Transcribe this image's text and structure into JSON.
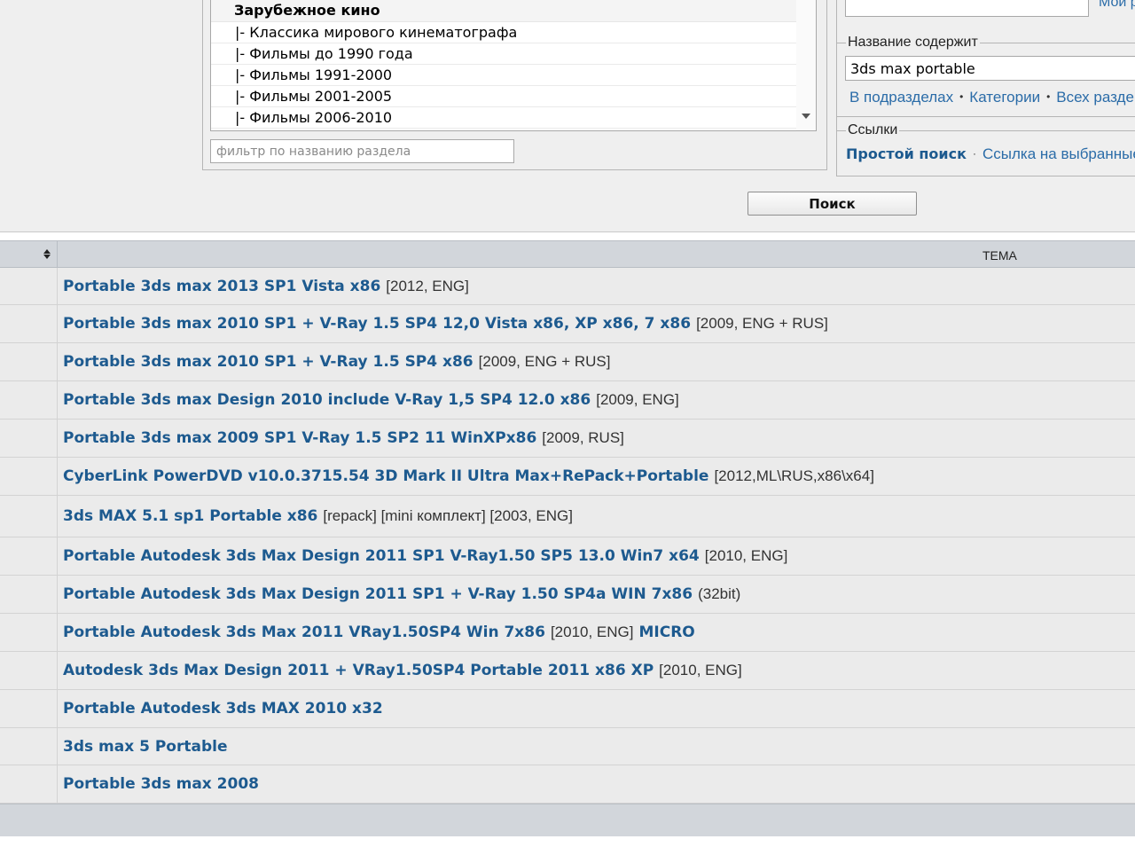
{
  "forum_list": {
    "category": "Зарубежное кино",
    "options": [
      "|- Классика мирового кинематографа",
      "|- Фильмы до 1990 года",
      "|- Фильмы 1991-2000",
      "|- Фильмы 2001-2005",
      "|- Фильмы 2006-2010"
    ],
    "filter_placeholder": "фильтр по названию раздела"
  },
  "right_panel": {
    "my_link": "Мои р",
    "title_contains": {
      "legend": "Название содержит",
      "value": "3ds max portable",
      "scope_links": [
        "В подразделах",
        "Категории",
        "Всех разде"
      ]
    },
    "links": {
      "legend": "Ссылки",
      "simple_search": "Простой поиск",
      "selected_link": "Ссылка на выбранные"
    }
  },
  "search_button": "Поиск",
  "results": {
    "column_header": "ТЕМА",
    "rows": [
      {
        "title": "Portable 3ds max 2013 SP1 Vista x86",
        "meta": "[2012, ENG]",
        "extra": ""
      },
      {
        "title": "Portable 3ds max 2010 SP1 + V-Ray 1.5 SP4 12,0 Vista x86, XP x86, 7 x86",
        "meta": "[2009, ENG + RUS]",
        "extra": ""
      },
      {
        "title": "Portable 3ds max 2010 SP1 + V-Ray 1.5 SP4 x86",
        "meta": "[2009, ENG + RUS]",
        "extra": ""
      },
      {
        "title": "Portable 3ds max Design 2010 include V-Ray 1,5 SP4 12.0 x86",
        "meta": "[2009, ENG]",
        "extra": ""
      },
      {
        "title": "Portable 3ds max 2009 SP1 V-Ray 1.5 SP2 11 WinXPx86",
        "meta": "[2009, RUS]",
        "extra": ""
      },
      {
        "title": "CyberLink PowerDVD v10.0.3715.54 3D Mark II Ultra Max+RePack+Portable",
        "meta": "[2012,ML\\RUS,x86\\x64]",
        "extra": ""
      },
      {
        "title": "3ds MAX 5.1 sp1 Portable x86",
        "meta": "[repack] [mini комплект] [2003, ENG]",
        "extra": ""
      },
      {
        "title": "Portable Autodesk 3ds Max Design 2011 SP1 V-Ray1.50 SP5 13.0 Win7 x64",
        "meta": "[2010, ENG]",
        "extra": ""
      },
      {
        "title": "Portable Autodesk 3ds Max Design 2011 SP1 + V-Ray 1.50 SP4a WIN 7x86",
        "meta": "(32bit)",
        "extra": ""
      },
      {
        "title": "Portable Autodesk 3ds Max 2011 VRay1.50SP4 Win 7x86",
        "meta": "[2010, ENG]",
        "extra": "MICRO"
      },
      {
        "title": "Autodesk 3ds Max Design 2011 + VRay1.50SP4 Portable 2011 x86 XP",
        "meta": "[2010, ENG]",
        "extra": ""
      },
      {
        "title": "Portable Autodesk 3ds MAX 2010 x32",
        "meta": "",
        "extra": ""
      },
      {
        "title": "3ds max 5 Portable",
        "meta": "",
        "extra": ""
      },
      {
        "title": "Portable 3ds max 2008",
        "meta": "",
        "extra": ""
      }
    ]
  }
}
